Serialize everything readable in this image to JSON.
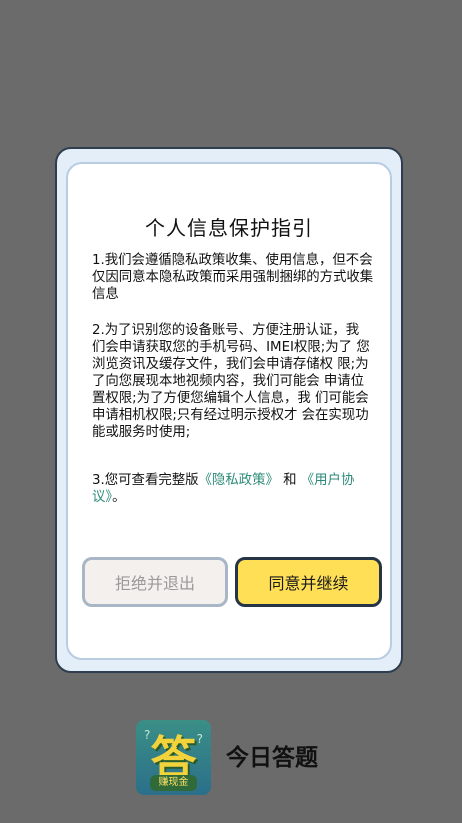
{
  "dialog": {
    "title": "个人信息保护指引",
    "para1": "1.我们会遵循隐私政策收集、使用信息，但不会仅因同意本隐私政策而采用强制捆绑的方式收集信息",
    "para2": "2.为了识别您的设备账号、方便注册认证，我 们会申请获取您的手机号码、IMEI权限;为了 您浏览资讯及缓存文件，我们会申请存储权 限;为了向您展现本地视频内容，我们可能会 申请位置权限;为了方便您编辑个人信息，我 们可能会申请相机权限;只有经过明示授权才 会在实现功能或服务时使用;",
    "para3_prefix": "3.您可查看完整版",
    "privacy_link": "《隐私政策》",
    "para3_and": "和",
    "user_link": "《用户协议》",
    "para3_suffix": "。",
    "reject_label": "拒绝并退出",
    "agree_label": "同意并继续"
  },
  "app": {
    "logo_char": "答",
    "logo_tag": "赚现金",
    "name": "今日答题"
  },
  "colors": {
    "overlay": "#6b6b6b",
    "agree_button": "#ffdf55",
    "link": "#2e8b7a"
  }
}
